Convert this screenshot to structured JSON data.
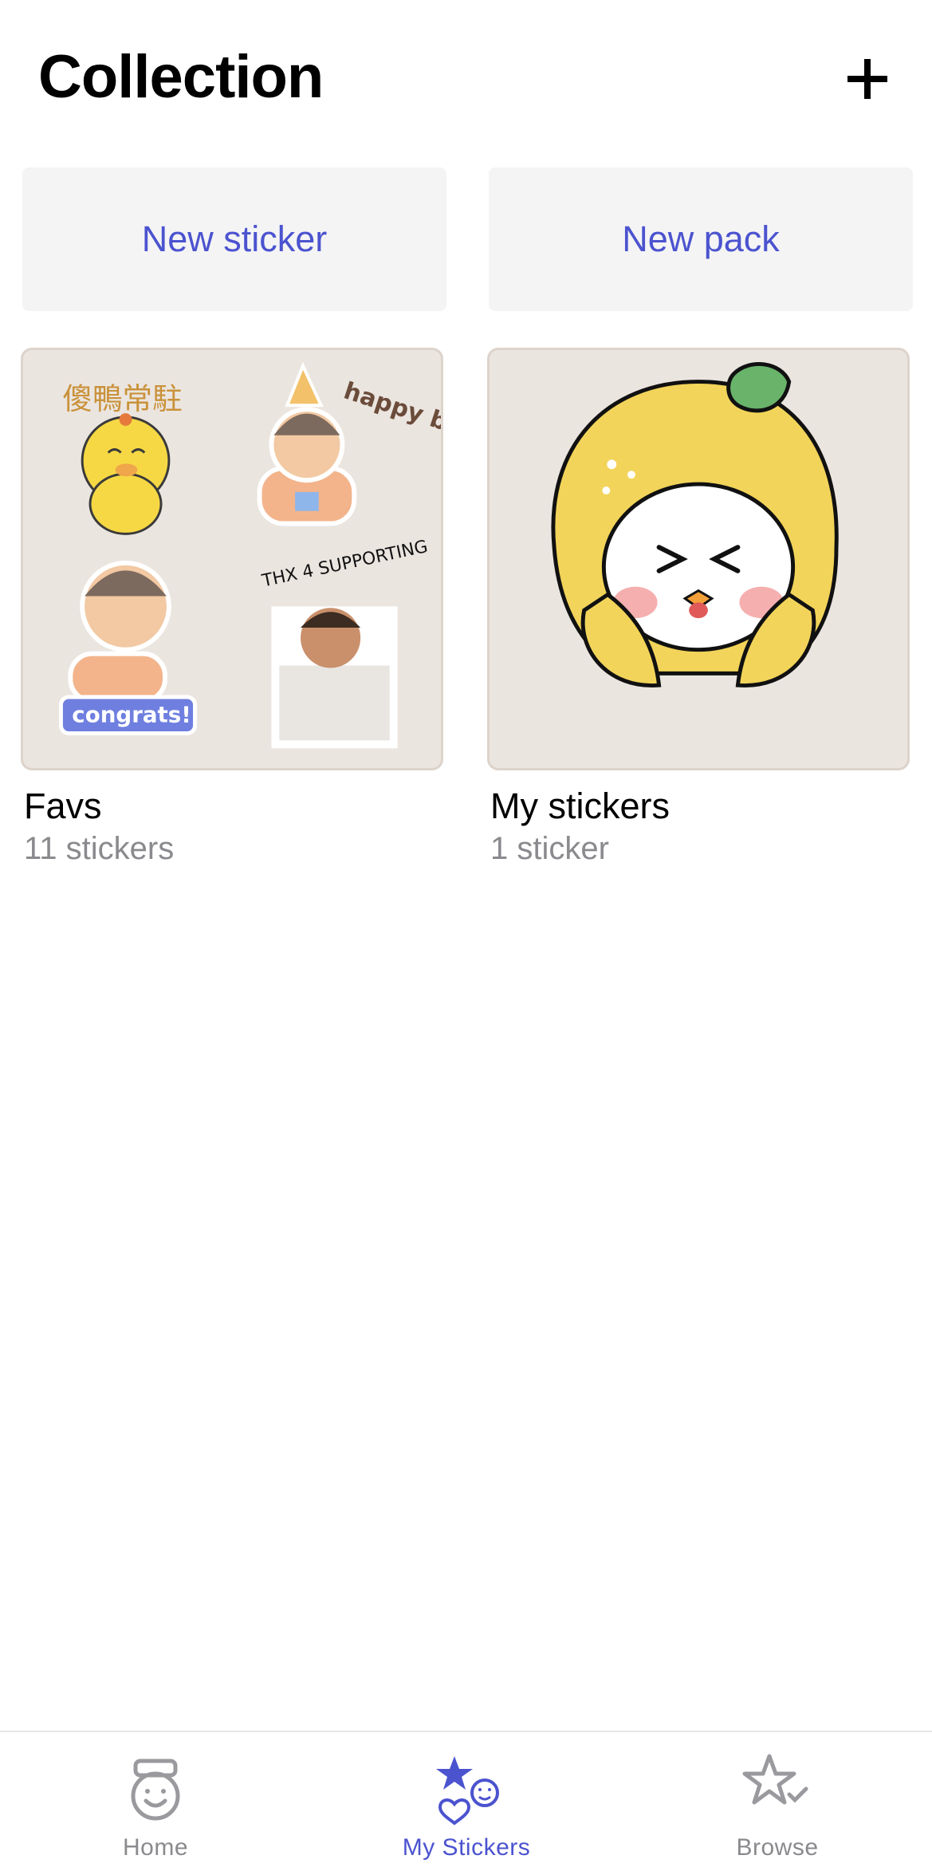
{
  "header": {
    "title": "Collection",
    "add_icon": "plus-icon"
  },
  "actions": {
    "new_sticker": "New sticker",
    "new_pack": "New pack"
  },
  "packs": [
    {
      "name": "Favs",
      "count": "11 stickers",
      "stickers": [
        {
          "text": "傻鴨常駐"
        },
        {
          "text": "happy birth- day!"
        },
        {
          "text": "congrats!"
        },
        {
          "text": "THX 4 SUPPORTING"
        }
      ]
    },
    {
      "name": "My stickers",
      "count": "1 sticker"
    }
  ],
  "tabbar": {
    "tabs": [
      {
        "label": "Home",
        "icon": "home-face-icon",
        "active": false
      },
      {
        "label": "My Stickers",
        "icon": "my-stickers-icon",
        "active": true
      },
      {
        "label": "Browse",
        "icon": "browse-star-icon",
        "active": false
      }
    ]
  },
  "colors": {
    "accent": "#4b53cf",
    "muted": "#8a8a8e",
    "button_bg": "#f4f4f5",
    "thumb_bg": "#ebe5e0"
  }
}
